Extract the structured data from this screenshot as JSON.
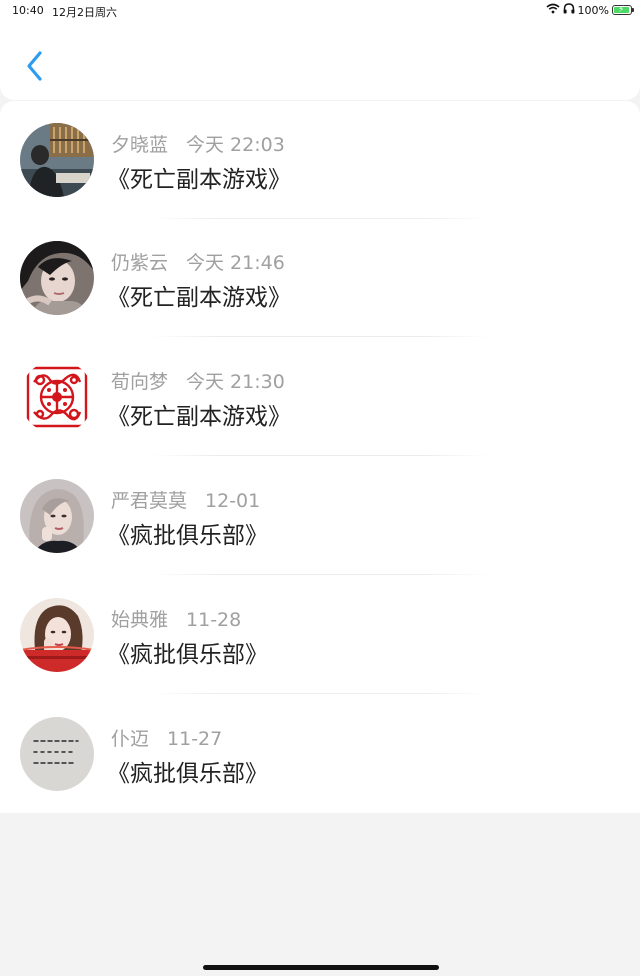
{
  "status_bar": {
    "time": "10:40",
    "date": "12月2日周六",
    "battery": "100%"
  },
  "nav": {
    "back_icon": "chevron-left-icon",
    "accent_color": "#2d9cf0"
  },
  "comments": [
    {
      "name": "夕晓蓝",
      "time": "今天 22:03",
      "title": "《死亡副本游戏》"
    },
    {
      "name": "仍紫云",
      "time": "今天 21:46",
      "title": "《死亡副本游戏》"
    },
    {
      "name": "荀向梦",
      "time": "今天 21:30",
      "title": "《死亡副本游戏》"
    },
    {
      "name": "严君莫莫",
      "time": "12-01",
      "title": "《疯批俱乐部》"
    },
    {
      "name": "始典雅",
      "time": "11-28",
      "title": "《疯批俱乐部》"
    },
    {
      "name": "仆迈",
      "time": "11-27",
      "title": "《疯批俱乐部》"
    }
  ]
}
